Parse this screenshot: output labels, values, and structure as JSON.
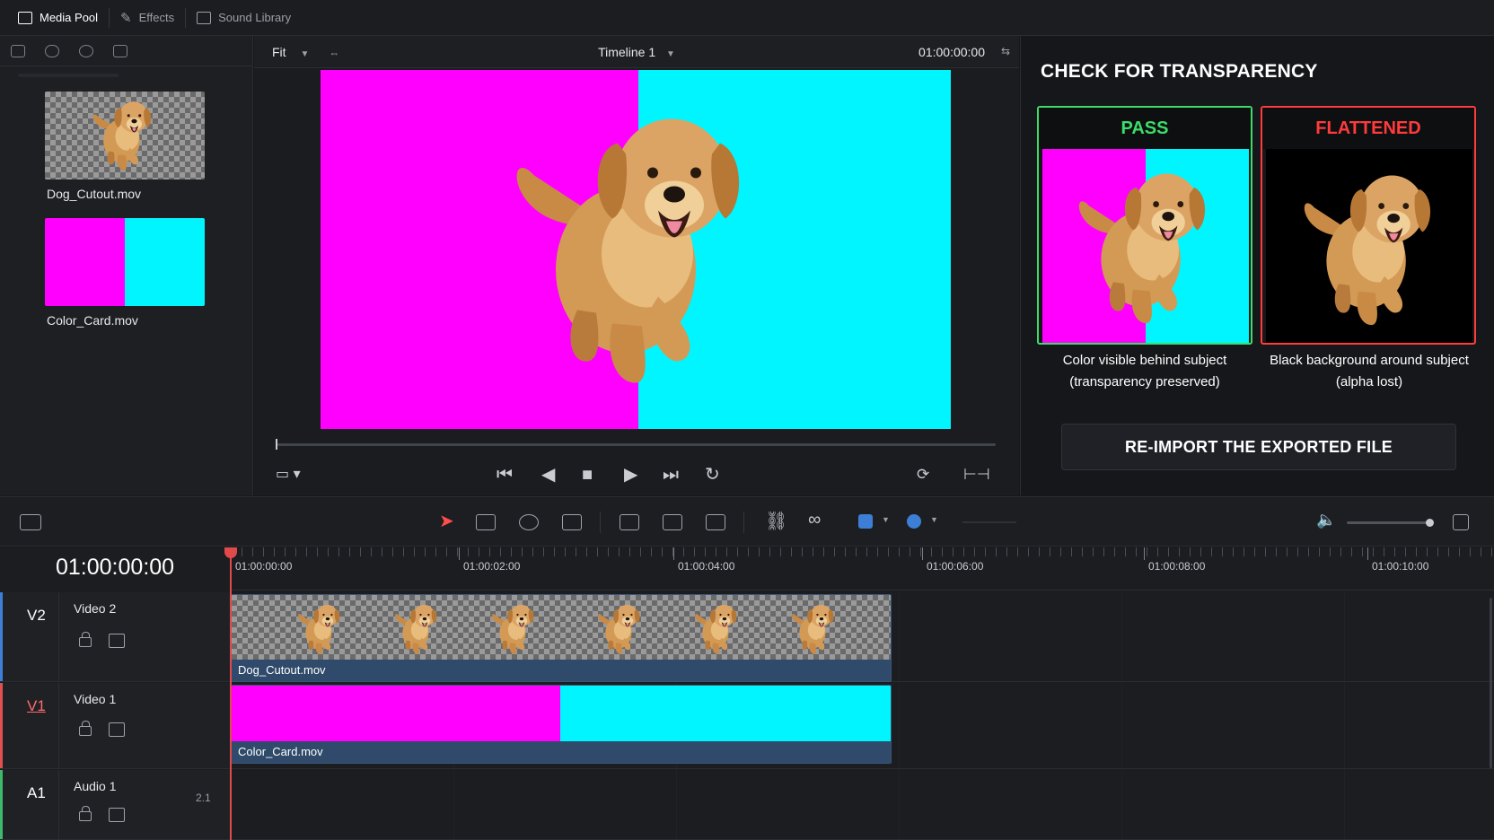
{
  "topbar": {
    "tabs": [
      {
        "label": "Media Pool",
        "icon": "media-pool-icon",
        "active": true
      },
      {
        "label": "Effects",
        "icon": "effects-wand-icon",
        "active": false
      },
      {
        "label": "Sound Library",
        "icon": "sound-library-icon",
        "active": false
      }
    ]
  },
  "media_pool": {
    "clips": [
      {
        "name": "Dog_Cutout.mov",
        "thumbnail": "checkerboard-with-dog"
      },
      {
        "name": "Color_Card.mov",
        "thumbnail": "magenta-cyan-split"
      }
    ]
  },
  "viewer": {
    "zoom": "Fit",
    "timeline_name": "Timeline 1",
    "timecode": "01:00:00:00"
  },
  "panel": {
    "title": "CHECK FOR TRANSPARENCY",
    "pass": {
      "label": "PASS",
      "caption_line1": "Color visible behind subject",
      "caption_line2": "(transparency preserved)",
      "color": "#3ddc68"
    },
    "flattened": {
      "label": "FLATTENED",
      "caption_line1": "Black background around subject",
      "caption_line2": "(alpha lost)",
      "color": "#ff3b3b"
    },
    "reimport_button": "RE-IMPORT THE EXPORTED FILE"
  },
  "timeline": {
    "timecode": "01:00:00:00",
    "ruler": [
      "01:00:00:00",
      "01:00:02:00",
      "01:00:04:00",
      "01:00:06:00",
      "01:00:08:00",
      "01:00:10:00"
    ],
    "tracks": [
      {
        "id": "V2",
        "name": "Video 2",
        "clip": "Dog_Cutout.mov",
        "color": "#3d7fd6"
      },
      {
        "id": "V1",
        "name": "Video 1",
        "clip": "Color_Card.mov",
        "color": "#e05050"
      },
      {
        "id": "A1",
        "name": "Audio 1",
        "channels": "2.1",
        "color": "#3dbb6a"
      }
    ]
  },
  "colors": {
    "magenta": "#ff00ff",
    "cyan": "#00f5ff",
    "playhead": "#e04a4a",
    "clip_label": "#2f4a6a"
  }
}
